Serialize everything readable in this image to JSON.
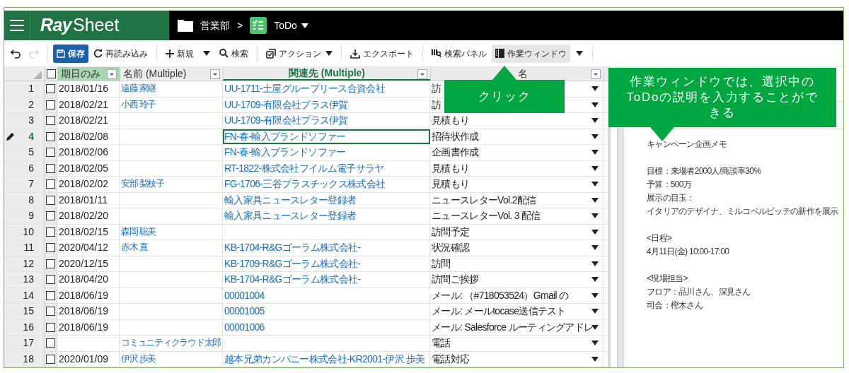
{
  "header": {
    "logo_bold": "Ray",
    "logo_light": "Sheet",
    "breadcrumb": [
      {
        "kind": "folder",
        "label": "営業部"
      },
      {
        "kind": "separator",
        "label": ">"
      },
      {
        "kind": "sheet",
        "label": "ToDo",
        "dropdown": true
      }
    ]
  },
  "toolbar": [
    {
      "kind": "undo",
      "disabled": false
    },
    {
      "kind": "redo",
      "disabled": true
    },
    {
      "kind": "divider"
    },
    {
      "kind": "save",
      "label": "保存",
      "primary": true
    },
    {
      "kind": "reload",
      "label": "再読み込み"
    },
    {
      "kind": "divider"
    },
    {
      "kind": "new",
      "label": "新規",
      "dropdown": true
    },
    {
      "kind": "search",
      "label": "検索"
    },
    {
      "kind": "divider"
    },
    {
      "kind": "action",
      "label": "アクション",
      "dropdown": true
    },
    {
      "kind": "divider"
    },
    {
      "kind": "export",
      "label": "エクスポート"
    },
    {
      "kind": "divider"
    },
    {
      "kind": "search_panel",
      "label": "検索パネル"
    },
    {
      "kind": "work_window",
      "label": "作業ウィンドウ",
      "selected": true,
      "dropdown": true
    },
    {
      "kind": "divider"
    }
  ],
  "table": {
    "header_checked": false,
    "columns": [
      {
        "label": "期日のみ",
        "filtered": true,
        "selected": false
      },
      {
        "label": "名前 (Multiple)",
        "filtered": false,
        "selected": false
      },
      {
        "label": "関連先 (Multiple)",
        "filtered": false,
        "selected": true
      },
      {
        "label": "名",
        "filtered": false,
        "selected": false
      }
    ],
    "rows": [
      {
        "number": "1",
        "checked": false,
        "editing": false,
        "date": "2018/01/16",
        "name": "遠藤 家継",
        "related": "UU-1711-土屋グループリース合資会社",
        "subject": "訪",
        "selected": false
      },
      {
        "number": "2",
        "checked": false,
        "editing": false,
        "date": "2018/02/21",
        "name": "小西 玲子",
        "related": "UU-1709-有限会社プラス伊賀",
        "subject": "訪",
        "selected": false
      },
      {
        "number": "3",
        "checked": false,
        "editing": false,
        "date": "2018/02/21",
        "name": "",
        "related": "UU-1709-有限会社プラス伊賀",
        "subject": "見積もり",
        "selected": false
      },
      {
        "number": "4",
        "checked": false,
        "editing": true,
        "date": "2018/02/08",
        "name": "",
        "related": "FN-春-輸入ブランドソファー",
        "subject": "招待状作成",
        "selected": true
      },
      {
        "number": "5",
        "checked": false,
        "editing": false,
        "date": "2018/02/06",
        "name": "",
        "related": "FN-春-輸入ブランドソファー",
        "subject": "企画書作成",
        "selected": false
      },
      {
        "number": "6",
        "checked": false,
        "editing": false,
        "date": "2018/02/05",
        "name": "",
        "related": "RT-1822-株式会社フイルム電子サラヤ",
        "subject": "見積もり",
        "selected": false
      },
      {
        "number": "7",
        "checked": false,
        "editing": false,
        "date": "2018/02/02",
        "name": "安部 梨枝子",
        "related": "FG-1706-三谷プラスチックス株式会社",
        "subject": "見積もり",
        "selected": false
      },
      {
        "number": "8",
        "checked": false,
        "editing": false,
        "date": "2018/01/11",
        "name": "",
        "related": "輸入家具ニュースレター登録者",
        "subject": "ニュースレターVol.2配信",
        "selected": false
      },
      {
        "number": "9",
        "checked": false,
        "editing": false,
        "date": "2018/02/20",
        "name": "",
        "related": "輸入家具ニュースレター登録者",
        "subject": "ニュースレターVol. 3 配信",
        "selected": false
      },
      {
        "number": "10",
        "checked": false,
        "editing": false,
        "date": "2018/02/15",
        "name": "森岡 聡美",
        "related": "",
        "subject": "訪問予定",
        "selected": false
      },
      {
        "number": "11",
        "checked": false,
        "editing": false,
        "date": "2020/04/12",
        "name": "赤木 直",
        "related": "KB-1704-R&Gゴーラム株式会社-",
        "subject": "状況確認",
        "selected": false
      },
      {
        "number": "12",
        "checked": false,
        "editing": false,
        "date": "2020/12/15",
        "name": "",
        "related": "KB-1709-R&Gゴーラム株式会社-",
        "subject": "訪問",
        "selected": false
      },
      {
        "number": "13",
        "checked": false,
        "editing": false,
        "date": "2018/04/20",
        "name": "",
        "related": "KB-1704-R&Gゴーラム株式会社-",
        "subject": "訪問ご挨拶",
        "selected": false
      },
      {
        "number": "14",
        "checked": false,
        "editing": false,
        "date": "2018/06/19",
        "name": "",
        "related": "00001004",
        "subject": "メール: （#718053524）Gmail の",
        "selected": false
      },
      {
        "number": "15",
        "checked": false,
        "editing": false,
        "date": "2018/06/19",
        "name": "",
        "related": "00001005",
        "subject": "メール: メールtocase送信テスト",
        "selected": false
      },
      {
        "number": "16",
        "checked": false,
        "editing": false,
        "date": "2018/06/19",
        "name": "",
        "related": "00001006",
        "subject": "メール: Salesforce ルーティングアドレ",
        "selected": false
      },
      {
        "number": "17",
        "checked": false,
        "editing": false,
        "date": "",
        "name": "コミュニティクラウド太郎",
        "related": "",
        "subject": "電話",
        "selected": false
      },
      {
        "number": "18",
        "checked": false,
        "editing": false,
        "date": "2020/01/09",
        "name": "伊沢 歩美",
        "related": "越本兄弟カンパニー株式会社-KR2001-伊沢 歩美",
        "subject": "電話対応",
        "selected": false
      }
    ]
  },
  "work_window": {
    "paragraphs": [
      [
        "キャンペーン企画メモ"
      ],
      [
        "目標：来場者2000人/商談率30%",
        "予算：500万",
        "展示の目玉：",
        "イタリアのデザイナ、ミルコベルビッチの新作を展示"
      ],
      [
        "<日程>",
        "4月11日(金) 10:00-17:00"
      ],
      [
        "<現場担当>",
        "フロア：品川さん、深見さん",
        "司会：樫木さん"
      ]
    ]
  },
  "callouts": [
    {
      "text": "クリック",
      "pointer_down": false
    },
    {
      "text": "作業ウィンドウでは、選択中のToDoの説明を入力することができる",
      "pointer_down": true
    }
  ]
}
